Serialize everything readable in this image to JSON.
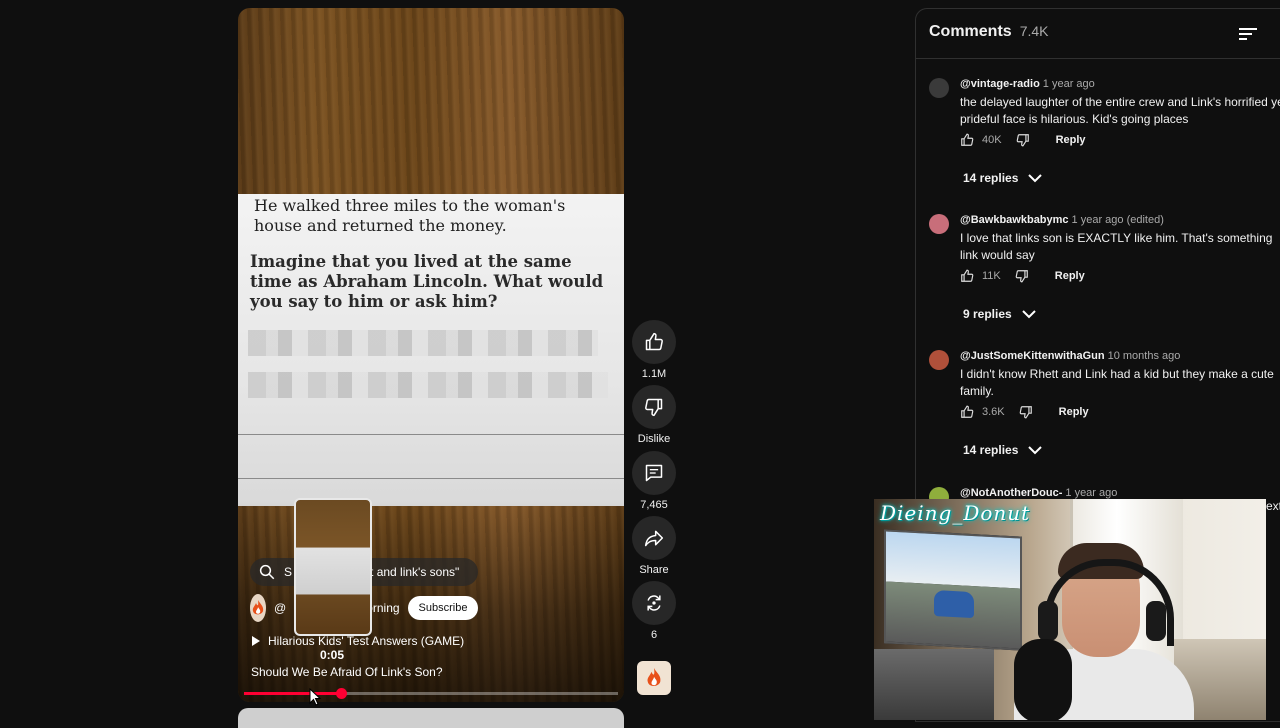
{
  "short": {
    "page_line": "He walked three miles to the woman's house and returned the money.",
    "question": "Imagine that you lived at the same time as Abraham Lincoln. What would you say to him or ask him?",
    "search_text_start": "S",
    "search_text_end": "ett and link's sons\"",
    "channel_start": "@",
    "channel_end": "Morning",
    "subscribe_label": "Subscribe",
    "linked_video": "Hilarious Kids' Test Answers (GAME)",
    "title": "Should We Be Afraid Of Link's Son?",
    "preview_time": "0:05",
    "progress_fraction": 0.26
  },
  "actions": {
    "likes": "1.1M",
    "dislike_label": "Dislike",
    "comments": "7,465",
    "share_label": "Share",
    "remix_count": "6"
  },
  "comments_panel": {
    "title": "Comments",
    "count": "7.4K",
    "items": [
      {
        "author": "@vintage-radio",
        "ago": "1 year ago",
        "text": "the delayed laughter of the entire crew and Link's horrified yet prideful face is hilarious. Kid's going places",
        "likes": "40K",
        "reply_label": "Reply",
        "replies": "14 replies"
      },
      {
        "author": "@Bawkbawkbabymc",
        "ago": "1 year ago (edited)",
        "text": "I love that links son is EXACTLY like him. That's something link would say",
        "likes": "11K",
        "reply_label": "Reply",
        "replies": "9 replies"
      },
      {
        "author": "@JustSomeKittenwithaGun",
        "ago": "10 months ago",
        "text": "I didn't know Rhett and Link had a kid but they make a cute family.",
        "likes": "3.6K",
        "reply_label": "Reply",
        "replies": "14 replies"
      },
      {
        "author": "@NotAnotherDouc-",
        "ago": "1 year ago"
      }
    ]
  },
  "webcam": {
    "streamer_name": "Dieing_Donut",
    "edge_text": "ext"
  },
  "colors": {
    "background": "#0f0f0f",
    "progress": "#ff0033",
    "subscribe_bg": "#ffffff",
    "cam_name_glow": "#00c8c8"
  },
  "icons": [
    "search-icon",
    "like-icon",
    "dislike-icon",
    "comment-icon",
    "share-icon",
    "remix-icon",
    "sort-icon",
    "chevron-down-icon",
    "flame-logo-icon"
  ]
}
